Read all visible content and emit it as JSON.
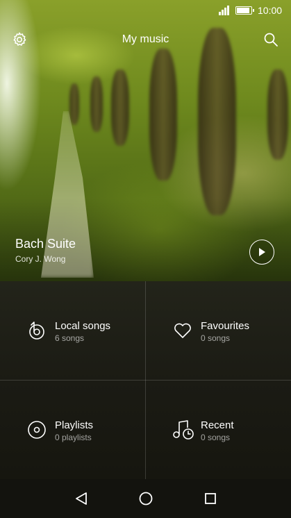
{
  "status_bar": {
    "time": "10:00"
  },
  "header": {
    "title": "My music"
  },
  "now_playing": {
    "title": "Bach Suite",
    "artist": "Cory J. Wong"
  },
  "tiles": [
    {
      "label": "Local songs",
      "sub": "6 songs",
      "icon": "local-songs-icon"
    },
    {
      "label": "Favourites",
      "sub": "0 songs",
      "icon": "heart-icon"
    },
    {
      "label": "Playlists",
      "sub": "0 playlists",
      "icon": "disc-icon"
    },
    {
      "label": "Recent",
      "sub": "0 songs",
      "icon": "recent-music-icon"
    }
  ],
  "nav": {
    "icons": [
      "back-icon",
      "home-icon",
      "recents-icon"
    ]
  },
  "colors": {
    "text": "#ffffff",
    "grid_bg": "#1b1b14",
    "divider": "#3a3a32"
  }
}
